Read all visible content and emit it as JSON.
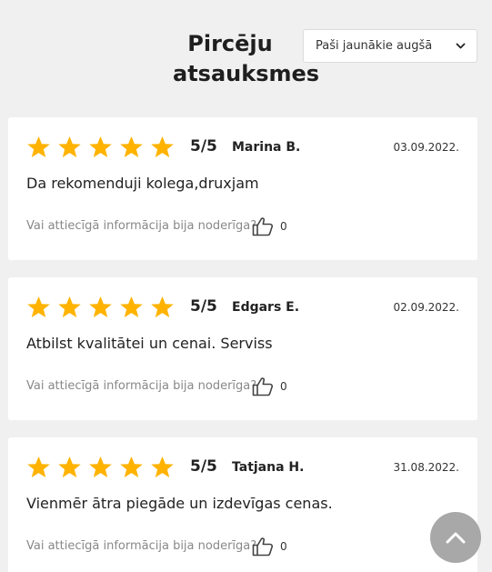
{
  "header": {
    "title": "Pircēju atsauksmes",
    "sort": {
      "selected": "Paši jaunākie augšā",
      "icon": "chevron-down-icon"
    }
  },
  "colors": {
    "star": "#FFB300",
    "background": "#F0F0F0",
    "card": "#FFFFFF",
    "scroll_button": "#A8A8A8"
  },
  "reviews": [
    {
      "rating": 5,
      "score": "5/5",
      "author": "Marina B.",
      "date": "03.09.2022.",
      "text": "Da rekomenduji kolega,druxjam",
      "helpful_label": "Vai attiecīgā informācija bija noderīga?",
      "likes": "0"
    },
    {
      "rating": 5,
      "score": "5/5",
      "author": "Edgars E.",
      "date": "02.09.2022.",
      "text": "Atbilst kvalitātei un cenai. Serviss",
      "helpful_label": "Vai attiecīgā informācija bija noderīga?",
      "likes": "0"
    },
    {
      "rating": 5,
      "score": "5/5",
      "author": "Tatjana H.",
      "date": "31.08.2022.",
      "text": "Vienmēr ātra piegāde un izdevīgas cenas.",
      "helpful_label": "Vai attiecīgā informācija bija noderīga?",
      "likes": "0"
    }
  ],
  "scroll_top": {
    "icon": "chevron-up-icon"
  }
}
